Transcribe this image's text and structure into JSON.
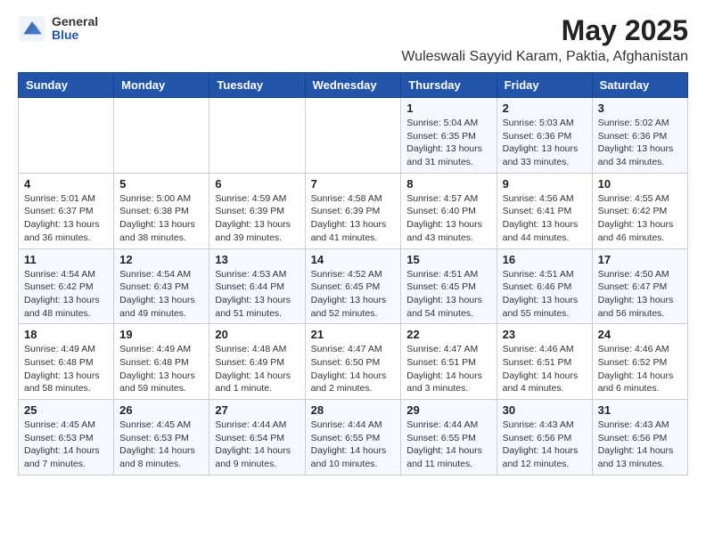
{
  "logo": {
    "general": "General",
    "blue": "Blue"
  },
  "header": {
    "month": "May 2025",
    "location": "Wuleswali Sayyid Karam, Paktia, Afghanistan"
  },
  "weekdays": [
    "Sunday",
    "Monday",
    "Tuesday",
    "Wednesday",
    "Thursday",
    "Friday",
    "Saturday"
  ],
  "weeks": [
    [
      {
        "day": "",
        "info": ""
      },
      {
        "day": "",
        "info": ""
      },
      {
        "day": "",
        "info": ""
      },
      {
        "day": "",
        "info": ""
      },
      {
        "day": "1",
        "info": "Sunrise: 5:04 AM\nSunset: 6:35 PM\nDaylight: 13 hours\nand 31 minutes."
      },
      {
        "day": "2",
        "info": "Sunrise: 5:03 AM\nSunset: 6:36 PM\nDaylight: 13 hours\nand 33 minutes."
      },
      {
        "day": "3",
        "info": "Sunrise: 5:02 AM\nSunset: 6:36 PM\nDaylight: 13 hours\nand 34 minutes."
      }
    ],
    [
      {
        "day": "4",
        "info": "Sunrise: 5:01 AM\nSunset: 6:37 PM\nDaylight: 13 hours\nand 36 minutes."
      },
      {
        "day": "5",
        "info": "Sunrise: 5:00 AM\nSunset: 6:38 PM\nDaylight: 13 hours\nand 38 minutes."
      },
      {
        "day": "6",
        "info": "Sunrise: 4:59 AM\nSunset: 6:39 PM\nDaylight: 13 hours\nand 39 minutes."
      },
      {
        "day": "7",
        "info": "Sunrise: 4:58 AM\nSunset: 6:39 PM\nDaylight: 13 hours\nand 41 minutes."
      },
      {
        "day": "8",
        "info": "Sunrise: 4:57 AM\nSunset: 6:40 PM\nDaylight: 13 hours\nand 43 minutes."
      },
      {
        "day": "9",
        "info": "Sunrise: 4:56 AM\nSunset: 6:41 PM\nDaylight: 13 hours\nand 44 minutes."
      },
      {
        "day": "10",
        "info": "Sunrise: 4:55 AM\nSunset: 6:42 PM\nDaylight: 13 hours\nand 46 minutes."
      }
    ],
    [
      {
        "day": "11",
        "info": "Sunrise: 4:54 AM\nSunset: 6:42 PM\nDaylight: 13 hours\nand 48 minutes."
      },
      {
        "day": "12",
        "info": "Sunrise: 4:54 AM\nSunset: 6:43 PM\nDaylight: 13 hours\nand 49 minutes."
      },
      {
        "day": "13",
        "info": "Sunrise: 4:53 AM\nSunset: 6:44 PM\nDaylight: 13 hours\nand 51 minutes."
      },
      {
        "day": "14",
        "info": "Sunrise: 4:52 AM\nSunset: 6:45 PM\nDaylight: 13 hours\nand 52 minutes."
      },
      {
        "day": "15",
        "info": "Sunrise: 4:51 AM\nSunset: 6:45 PM\nDaylight: 13 hours\nand 54 minutes."
      },
      {
        "day": "16",
        "info": "Sunrise: 4:51 AM\nSunset: 6:46 PM\nDaylight: 13 hours\nand 55 minutes."
      },
      {
        "day": "17",
        "info": "Sunrise: 4:50 AM\nSunset: 6:47 PM\nDaylight: 13 hours\nand 56 minutes."
      }
    ],
    [
      {
        "day": "18",
        "info": "Sunrise: 4:49 AM\nSunset: 6:48 PM\nDaylight: 13 hours\nand 58 minutes."
      },
      {
        "day": "19",
        "info": "Sunrise: 4:49 AM\nSunset: 6:48 PM\nDaylight: 13 hours\nand 59 minutes."
      },
      {
        "day": "20",
        "info": "Sunrise: 4:48 AM\nSunset: 6:49 PM\nDaylight: 14 hours\nand 1 minute."
      },
      {
        "day": "21",
        "info": "Sunrise: 4:47 AM\nSunset: 6:50 PM\nDaylight: 14 hours\nand 2 minutes."
      },
      {
        "day": "22",
        "info": "Sunrise: 4:47 AM\nSunset: 6:51 PM\nDaylight: 14 hours\nand 3 minutes."
      },
      {
        "day": "23",
        "info": "Sunrise: 4:46 AM\nSunset: 6:51 PM\nDaylight: 14 hours\nand 4 minutes."
      },
      {
        "day": "24",
        "info": "Sunrise: 4:46 AM\nSunset: 6:52 PM\nDaylight: 14 hours\nand 6 minutes."
      }
    ],
    [
      {
        "day": "25",
        "info": "Sunrise: 4:45 AM\nSunset: 6:53 PM\nDaylight: 14 hours\nand 7 minutes."
      },
      {
        "day": "26",
        "info": "Sunrise: 4:45 AM\nSunset: 6:53 PM\nDaylight: 14 hours\nand 8 minutes."
      },
      {
        "day": "27",
        "info": "Sunrise: 4:44 AM\nSunset: 6:54 PM\nDaylight: 14 hours\nand 9 minutes."
      },
      {
        "day": "28",
        "info": "Sunrise: 4:44 AM\nSunset: 6:55 PM\nDaylight: 14 hours\nand 10 minutes."
      },
      {
        "day": "29",
        "info": "Sunrise: 4:44 AM\nSunset: 6:55 PM\nDaylight: 14 hours\nand 11 minutes."
      },
      {
        "day": "30",
        "info": "Sunrise: 4:43 AM\nSunset: 6:56 PM\nDaylight: 14 hours\nand 12 minutes."
      },
      {
        "day": "31",
        "info": "Sunrise: 4:43 AM\nSunset: 6:56 PM\nDaylight: 14 hours\nand 13 minutes."
      }
    ]
  ]
}
